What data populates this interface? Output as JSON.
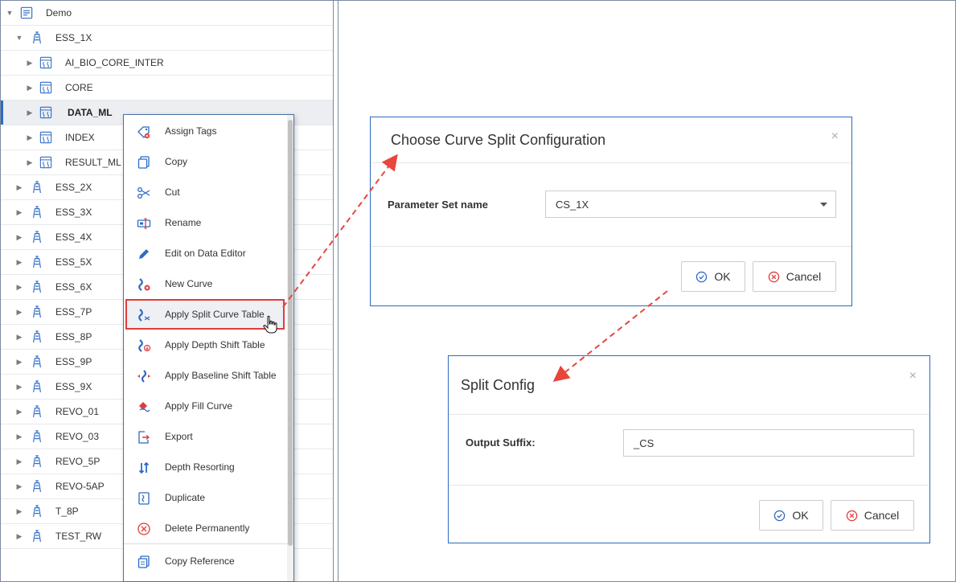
{
  "tree": {
    "root": {
      "label": "Demo"
    },
    "well_expanded": {
      "label": "ESS_1X"
    },
    "datasets": [
      {
        "label": "AI_BIO_CORE_INTER"
      },
      {
        "label": "CORE"
      },
      {
        "label": "DATA_ML"
      },
      {
        "label": "INDEX"
      },
      {
        "label": "RESULT_ML"
      }
    ],
    "wells": [
      {
        "label": "ESS_2X"
      },
      {
        "label": "ESS_3X"
      },
      {
        "label": "ESS_4X"
      },
      {
        "label": "ESS_5X"
      },
      {
        "label": "ESS_6X"
      },
      {
        "label": "ESS_7P"
      },
      {
        "label": "ESS_8P"
      },
      {
        "label": "ESS_9P"
      },
      {
        "label": "ESS_9X"
      },
      {
        "label": "REVO_01"
      },
      {
        "label": "REVO_03"
      },
      {
        "label": "REVO_5P"
      },
      {
        "label": "REVO-5AP"
      },
      {
        "label": "T_8P"
      },
      {
        "label": "TEST_RW"
      }
    ]
  },
  "context_menu": {
    "items": [
      {
        "label": "Assign Tags",
        "icon": "tag-icon"
      },
      {
        "label": "Copy",
        "icon": "copy-icon"
      },
      {
        "label": "Cut",
        "icon": "scissors-icon"
      },
      {
        "label": "Rename",
        "icon": "rename-icon"
      },
      {
        "label": "Edit on Data Editor",
        "icon": "pencil-icon"
      },
      {
        "label": "New Curve",
        "icon": "new-curve-icon"
      },
      {
        "label": "Apply Split Curve Table",
        "icon": "split-curve-icon"
      },
      {
        "label": "Apply Depth Shift Table",
        "icon": "depth-shift-icon"
      },
      {
        "label": "Apply Baseline Shift Table",
        "icon": "baseline-shift-icon"
      },
      {
        "label": "Apply Fill Curve",
        "icon": "fill-curve-icon"
      },
      {
        "label": "Export",
        "icon": "export-icon"
      },
      {
        "label": "Depth Resorting",
        "icon": "depth-resort-icon"
      },
      {
        "label": "Duplicate",
        "icon": "duplicate-icon"
      },
      {
        "label": "Delete Permanently",
        "icon": "delete-icon"
      }
    ],
    "footer_item": {
      "label": "Copy Reference",
      "icon": "copy-reference-icon"
    }
  },
  "dialog_split_config_choose": {
    "title": "Choose Curve Split Configuration",
    "close": "×",
    "field_label": "Parameter Set name",
    "selected_value": "CS_1X",
    "ok_label": "OK",
    "cancel_label": "Cancel"
  },
  "dialog_split_config": {
    "title": "Split Config",
    "close": "×",
    "field_label": "Output Suffix:",
    "field_value": "_CS",
    "ok_label": "OK",
    "cancel_label": "Cancel"
  },
  "colors": {
    "accent_blue": "#2d6bc4",
    "highlight_red": "#e03c3c",
    "arrow_red": "#e8453c"
  }
}
